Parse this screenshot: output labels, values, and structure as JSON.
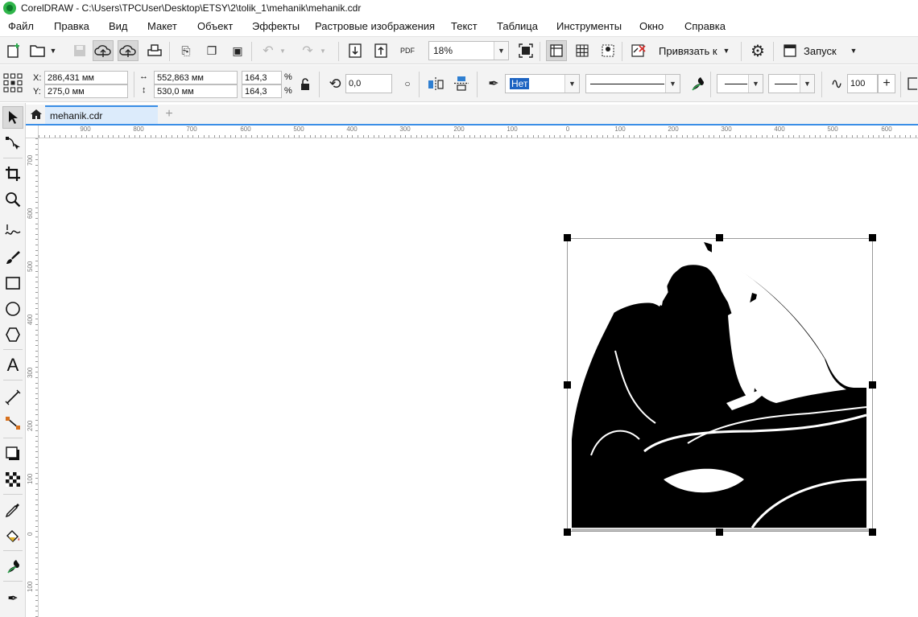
{
  "window": {
    "title": "CorelDRAW - C:\\Users\\TPCUser\\Desktop\\ETSY\\2\\tolik_1\\mehanik\\mehanik.cdr"
  },
  "menu": [
    "Файл",
    "Правка",
    "Вид",
    "Макет",
    "Объект",
    "Эффекты",
    "Растровые изображения",
    "Текст",
    "Таблица",
    "Инструменты",
    "Окно",
    "Справка"
  ],
  "standard_toolbar": {
    "zoom_value": "18%",
    "snap_label": "Привязать к",
    "launch_label": "Запуск",
    "pdf_label": "PDF"
  },
  "property_bar": {
    "x_label": "X:",
    "x_value": "286,431 мм",
    "y_label": "Y:",
    "y_value": "275,0 мм",
    "width_value": "552,863 мм",
    "height_value": "530,0 мм",
    "scale_x": "164,3",
    "scale_y": "164,3",
    "percent": "%",
    "rotation": "0,0",
    "outline_width": "Нет",
    "smoothing": "100"
  },
  "document": {
    "tab_name": "mehanik.cdr"
  },
  "ruler": {
    "h_labels": [
      "900",
      "800",
      "700",
      "600",
      "500",
      "400",
      "300",
      "200",
      "100",
      "0",
      "100",
      "200",
      "300",
      "400",
      "500",
      "600"
    ],
    "v_labels": [
      "700",
      "600",
      "500",
      "400",
      "300",
      "200",
      "100",
      "0",
      "100"
    ]
  },
  "icons": {
    "colors": {
      "accent": "#3a8ee6",
      "app_green": "#2fb54a",
      "selection": "#000000"
    }
  }
}
